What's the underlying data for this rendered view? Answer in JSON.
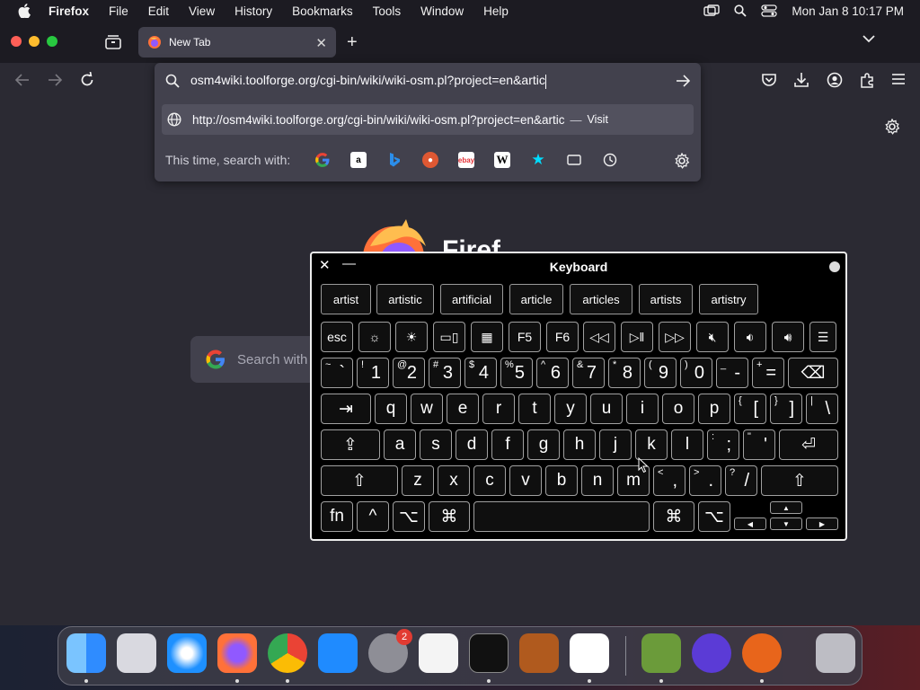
{
  "menubar": {
    "app_name": "Firefox",
    "items": [
      "File",
      "Edit",
      "View",
      "History",
      "Bookmarks",
      "Tools",
      "Window",
      "Help"
    ],
    "clock": "Mon Jan 8  10:17 PM"
  },
  "tab": {
    "title": "New Tab"
  },
  "urlbar": {
    "value": "osm4wiki.toolforge.org/cgi-bin/wiki/wiki-osm.pl?project=en&artic",
    "suggestion_url": "http://osm4wiki.toolforge.org/cgi-bin/wiki/wiki-osm.pl?project=en&artic",
    "suggestion_sep": "—",
    "suggestion_action": "Visit",
    "search_with_label": "This time, search with:",
    "engines": [
      "google-icon",
      "amazon-icon",
      "bing-icon",
      "duckduckgo-icon",
      "ebay-icon",
      "wikipedia-icon",
      "bookmarks-star-icon",
      "tabs-icon",
      "history-icon"
    ]
  },
  "newtab": {
    "brand_partial": "Firef",
    "search_placeholder": "Search with"
  },
  "keyboard": {
    "title": "Keyboard",
    "candidates": [
      "artist",
      "artistic",
      "artificial",
      "article",
      "articles",
      "artists",
      "artistry"
    ],
    "fn_row": [
      "esc",
      "F5",
      "F6"
    ],
    "number_row": [
      {
        "shift": "~",
        "main": "`"
      },
      {
        "shift": "!",
        "main": "1"
      },
      {
        "shift": "@",
        "main": "2"
      },
      {
        "shift": "#",
        "main": "3"
      },
      {
        "shift": "$",
        "main": "4"
      },
      {
        "shift": "%",
        "main": "5"
      },
      {
        "shift": "^",
        "main": "6"
      },
      {
        "shift": "&",
        "main": "7"
      },
      {
        "shift": "*",
        "main": "8"
      },
      {
        "shift": "(",
        "main": "9"
      },
      {
        "shift": ")",
        "main": "0"
      },
      {
        "shift": "_",
        "main": "-"
      },
      {
        "shift": "+",
        "main": "="
      }
    ],
    "row_q": [
      "q",
      "w",
      "e",
      "r",
      "t",
      "y",
      "u",
      "i",
      "o",
      "p"
    ],
    "row_q_extra": [
      {
        "shift": "{",
        "main": "["
      },
      {
        "shift": "}",
        "main": "]"
      },
      {
        "shift": "|",
        "main": "\\"
      }
    ],
    "row_a": [
      "a",
      "s",
      "d",
      "f",
      "g",
      "h",
      "j",
      "k",
      "l"
    ],
    "row_a_extra": [
      {
        "shift": ":",
        "main": ";"
      },
      {
        "shift": "\"",
        "main": "'"
      }
    ],
    "row_z": [
      "z",
      "x",
      "c",
      "v",
      "b",
      "n",
      "m"
    ],
    "row_z_extra": [
      {
        "shift": "<",
        "main": ","
      },
      {
        "shift": ">",
        "main": "."
      },
      {
        "shift": "?",
        "main": "/"
      }
    ],
    "bottom": {
      "fn": "fn",
      "ctrl": "^",
      "opt": "⌥",
      "cmd": "⌘"
    }
  },
  "dock": {
    "apps": [
      "finder-icon",
      "launchpad-icon",
      "safari-icon",
      "firefox-icon",
      "chrome-icon",
      "app-store-icon",
      "system-settings-icon",
      "textedit-icon",
      "terminal-icon",
      "garageband-icon",
      "vscode-icon",
      "minecraft-icon",
      "imovie-icon",
      "ardour-icon",
      "trash-icon"
    ],
    "settings_badge": "2"
  }
}
